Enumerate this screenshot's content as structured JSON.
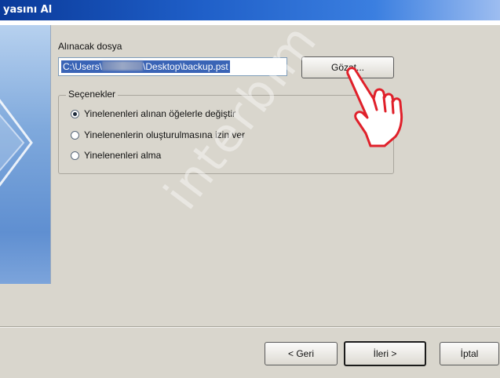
{
  "window": {
    "title": "yasını Al"
  },
  "form": {
    "file_label": "Alınacak dosya",
    "file_path_prefix": "C:\\Users\\",
    "file_path_suffix": "\\Desktop\\backup.pst",
    "browse_label": "Gözat..."
  },
  "options": {
    "legend": "Seçenekler",
    "items": [
      {
        "label": "Yinelenenleri alınan öğelerle değiştir",
        "selected": true
      },
      {
        "label": "Yinelenenlerin oluşturulmasına izin ver",
        "selected": false
      },
      {
        "label": "Yinelenenleri alma",
        "selected": false
      }
    ]
  },
  "footer": {
    "back_label": "< Geri",
    "next_label": "İleri >",
    "cancel_label": "İptal"
  },
  "watermark": "interbim",
  "colors": {
    "titlebar": "#1f5fc8",
    "selection": "#3a64b6",
    "hand_cursor": "#e0202a"
  },
  "icons": [
    "hand-pointer-icon"
  ]
}
